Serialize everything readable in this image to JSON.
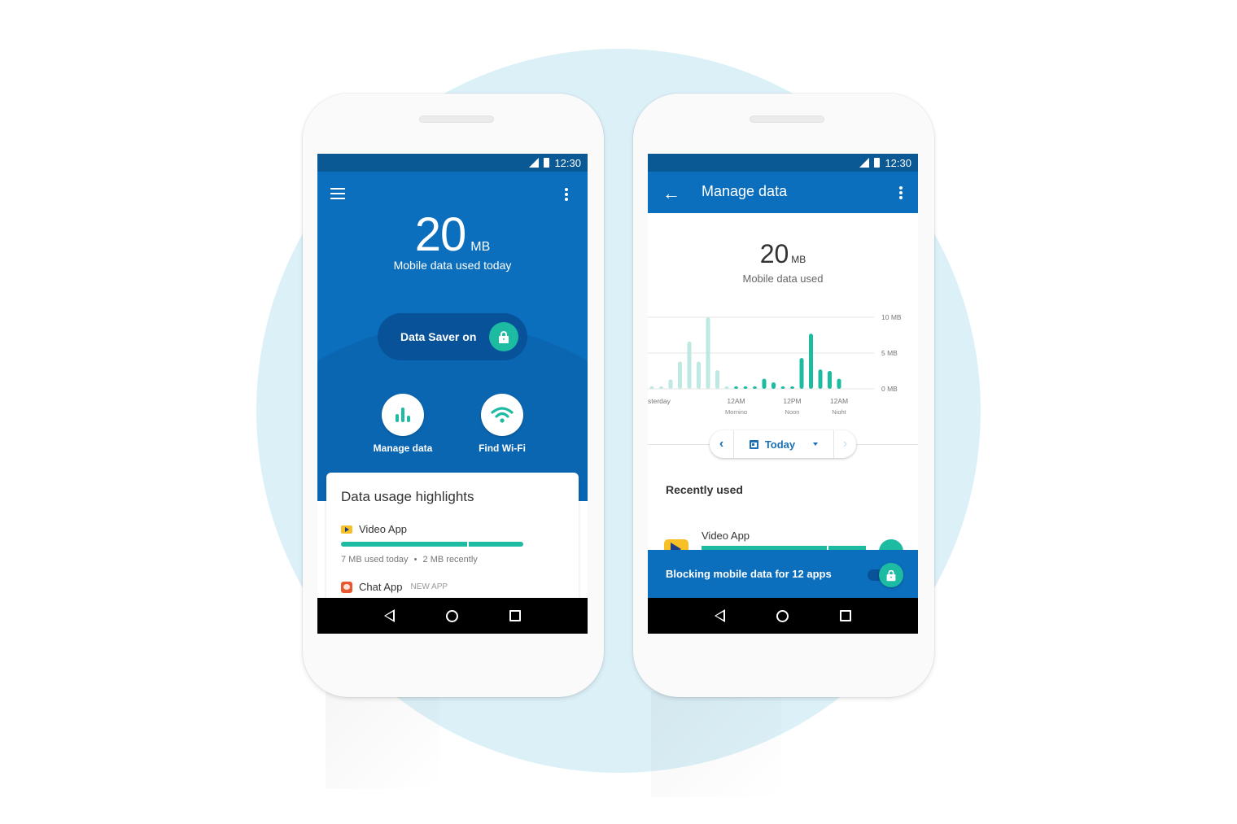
{
  "colors": {
    "primary": "#0b6fbe",
    "primary_dark": "#0a5994",
    "accent": "#1dbba2",
    "accent_light": "#bde9e2",
    "background_circle": "#dcf0f8"
  },
  "status_bar": {
    "time": "12:30",
    "signal_icon": "signal-icon",
    "battery_icon": "battery-icon"
  },
  "home_screen": {
    "menu_icon": "hamburger-menu-icon",
    "overflow_icon": "more-vert-icon",
    "usage_value": "20",
    "usage_unit": "MB",
    "usage_caption": "Mobile data used today",
    "data_saver_label": "Data Saver on",
    "data_saver_icon": "lock-icon",
    "actions": [
      {
        "label": "Manage data",
        "icon": "bar-chart-icon"
      },
      {
        "label": "Find Wi-Fi",
        "icon": "wifi-icon"
      }
    ],
    "highlights": {
      "title": "Data usage highlights",
      "apps": [
        {
          "name": "Video App",
          "icon": "video-app-icon",
          "today_fraction": 0.7,
          "recent_fraction": 0.3,
          "meta_today": "7 MB used today",
          "meta_separator": "•",
          "meta_recent": "2 MB recently"
        },
        {
          "name": "Chat App",
          "icon": "chat-app-icon",
          "badge": "NEW APP"
        }
      ]
    }
  },
  "manage_screen": {
    "back_icon": "arrow-back-icon",
    "title": "Manage data",
    "overflow_icon": "more-vert-icon",
    "usage_value": "20",
    "usage_unit": "MB",
    "usage_caption": "Mobile data used",
    "date_selector": {
      "prev_icon": "chevron-left-icon",
      "calendar_icon": "calendar-icon",
      "label": "Today",
      "dropdown_icon": "caret-down-icon",
      "next_icon": "chevron-right-icon"
    },
    "recently_used": {
      "title": "Recently used",
      "apps": [
        {
          "name": "Video App",
          "icon": "video-app-icon",
          "today_fraction": 0.77,
          "recent_fraction": 0.23,
          "lock_icon": "lock-icon"
        }
      ]
    },
    "blocking_banner": {
      "label": "Blocking mobile data for 12 apps",
      "toggle_on": true
    }
  },
  "chart_data": {
    "type": "bar",
    "title": "",
    "xlabel": "",
    "ylabel": "",
    "ylim": [
      0,
      10
    ],
    "y_ticks": [
      "0 MB",
      "5 MB",
      "10 MB"
    ],
    "y_tick_values": [
      0,
      5,
      10
    ],
    "grid": true,
    "x_tick_labels": [
      {
        "line1": "sterday",
        "line2": "",
        "index": 0
      },
      {
        "line1": "12AM",
        "line2": "Morning",
        "index": 9
      },
      {
        "line1": "12PM",
        "line2": "Noon",
        "index": 15
      },
      {
        "line1": "12AM",
        "line2": "Night",
        "index": 20
      }
    ],
    "series": [
      {
        "name": "Yesterday",
        "color": "#bde9e2",
        "values": [
          0.2,
          0.3,
          1.3,
          3.8,
          6.6,
          3.8,
          10,
          2.6,
          0.3
        ]
      },
      {
        "name": "Today",
        "color": "#1dbba2",
        "values": [
          0.3,
          0.3,
          0.3,
          1.4,
          0.9,
          0.3,
          0.3,
          4.3,
          7.7,
          2.7,
          2.5,
          1.4
        ]
      }
    ]
  },
  "nav_bar": {
    "back_icon": "nav-back-icon",
    "home_icon": "nav-home-icon",
    "recents_icon": "nav-recents-icon"
  }
}
